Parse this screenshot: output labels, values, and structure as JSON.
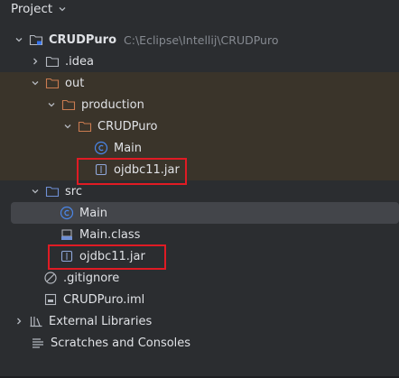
{
  "panel": {
    "title": "Project"
  },
  "colors": {
    "background": "#2b2d30",
    "excluded_bg": "#3a342a",
    "selected_bg": "#43454a",
    "highlight_border": "#e01b24",
    "folder_orange": "#c97b50",
    "folder_blue": "#6f8fd4",
    "class_blue": "#4a86e8"
  },
  "tree": {
    "root": {
      "label": "CRUDPuro",
      "path": "C:\\Eclipse\\Intellij\\CRUDPuro",
      "icon": "module-folder-icon",
      "expanded": true
    },
    "idea": {
      "label": ".idea",
      "icon": "folder-icon",
      "expanded": false
    },
    "out": {
      "label": "out",
      "icon": "excluded-folder-icon",
      "expanded": true
    },
    "production": {
      "label": "production",
      "icon": "excluded-folder-icon",
      "expanded": true
    },
    "crudpuro_out": {
      "label": "CRUDPuro",
      "icon": "excluded-folder-icon",
      "expanded": true
    },
    "main_out": {
      "label": "Main",
      "icon": "class-icon"
    },
    "jar_out": {
      "label": "ojdbc11.jar",
      "icon": "jar-icon",
      "highlighted": true
    },
    "src": {
      "label": "src",
      "icon": "source-folder-icon",
      "expanded": true
    },
    "main_src": {
      "label": "Main",
      "icon": "class-icon",
      "selected": true
    },
    "main_class": {
      "label": "Main.class",
      "icon": "compiled-class-icon"
    },
    "jar_src": {
      "label": "ojdbc11.jar",
      "icon": "jar-icon",
      "highlighted": true
    },
    "gitignore": {
      "label": ".gitignore",
      "icon": "ignore-icon"
    },
    "iml": {
      "label": "CRUDPuro.iml",
      "icon": "iml-file-icon"
    },
    "external": {
      "label": "External Libraries",
      "icon": "library-icon",
      "expanded": false
    },
    "scratches": {
      "label": "Scratches and Consoles",
      "icon": "scratches-icon"
    }
  }
}
